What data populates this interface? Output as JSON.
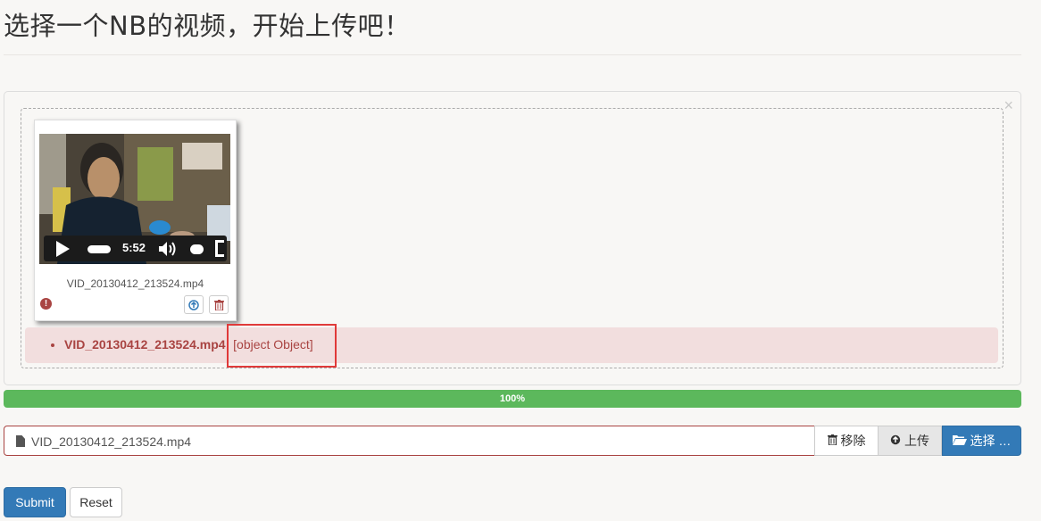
{
  "page": {
    "title": "选择一个NB的视频，开始上传吧！"
  },
  "preview": {
    "close_glyph": "×",
    "video": {
      "time": "5:52"
    },
    "file_caption": "VID_20130412_213524.mp4",
    "error_glyph": "!",
    "upload_glyph": "⬆",
    "delete_glyph": "🗑"
  },
  "error_message": {
    "file": "VID_20130412_213524.mp4",
    "separator": ":",
    "text": " [object Object]"
  },
  "progress": {
    "label": "100%",
    "value": 100
  },
  "file_input": {
    "caption": "VID_20130412_213524.mp4",
    "remove_label": "移除",
    "upload_label": "上传",
    "browse_label": "选择 …"
  },
  "form": {
    "submit_label": "Submit",
    "reset_label": "Reset"
  },
  "colors": {
    "progress": "#5cb85c",
    "primary": "#337ab7",
    "error": "#a94442",
    "error_bg": "#f2dede",
    "highlight": "#e03a3a"
  },
  "icons": [
    "close-icon",
    "play-icon",
    "volume-icon",
    "fullscreen-icon",
    "error-icon",
    "upload-icon",
    "trash-icon",
    "file-icon",
    "folder-open-icon"
  ]
}
